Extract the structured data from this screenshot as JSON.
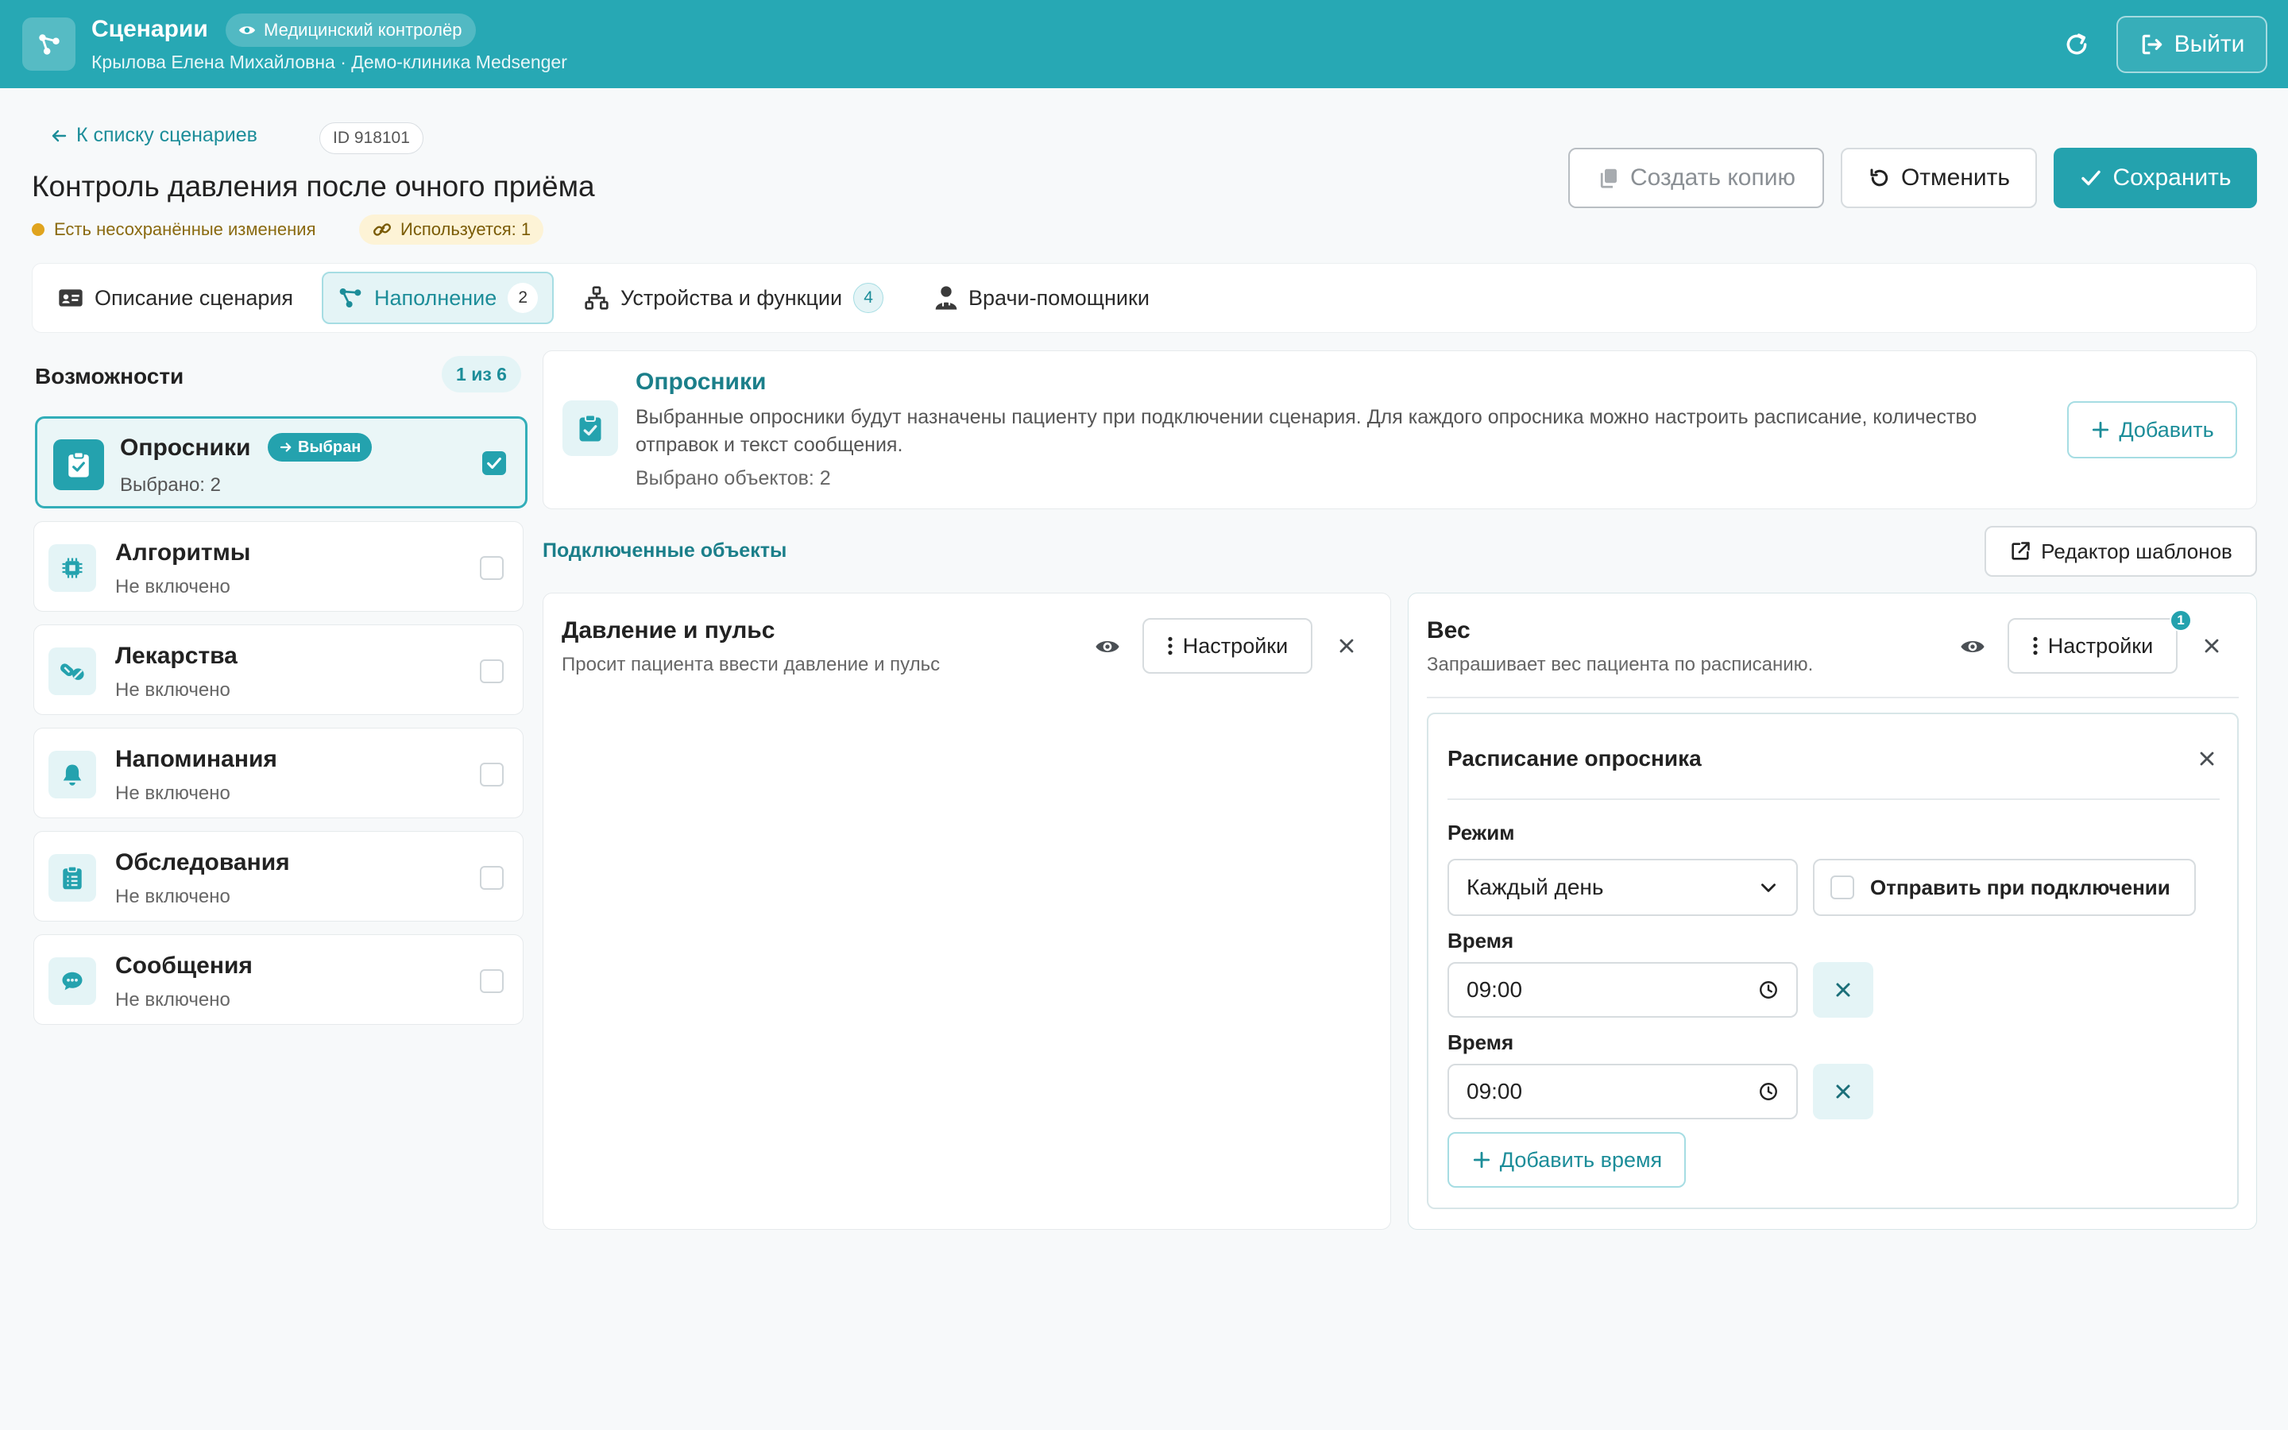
{
  "header": {
    "app_title": "Сценарии",
    "role_badge": "Медицинский контролёр",
    "user_line": "Крылова Елена Михайловна · Демо-клиника Medsenger",
    "logout_label": "Выйти",
    "accent_color": "#27a8b4"
  },
  "page": {
    "back_link": "К списку сценариев",
    "id_chip": "ID 918101",
    "title": "Контроль давления после очного приёма",
    "unsaved_text": "Есть несохранённые изменения",
    "used_text": "Используется: 1",
    "actions": {
      "copy_label": "Создать копию",
      "cancel_label": "Отменить",
      "save_label": "Сохранить"
    }
  },
  "tabs": [
    {
      "label": "Описание сценария",
      "count": null,
      "icon": "id-card-icon"
    },
    {
      "label": "Наполнение",
      "count": "2",
      "icon": "nodes-icon",
      "active": true
    },
    {
      "label": "Устройства и функции",
      "count": "4",
      "icon": "network-icon"
    },
    {
      "label": "Врачи-помощники",
      "count": null,
      "icon": "user-doctor-icon"
    }
  ],
  "capabilities": {
    "title": "Возможности",
    "count": "1 из 6",
    "selected_pill": "Выбран",
    "items": [
      {
        "name": "Опросники",
        "status": "Выбрано: 2",
        "icon": "clipboard-check-icon",
        "selected": true
      },
      {
        "name": "Алгоритмы",
        "status": "Не включено",
        "icon": "chip-icon",
        "selected": false
      },
      {
        "name": "Лекарства",
        "status": "Не включено",
        "icon": "pills-icon",
        "selected": false
      },
      {
        "name": "Напоминания",
        "status": "Не включено",
        "icon": "bell-icon",
        "selected": false
      },
      {
        "name": "Обследования",
        "status": "Не включено",
        "icon": "clipboard-list-icon",
        "selected": false
      },
      {
        "name": "Сообщения",
        "status": "Не включено",
        "icon": "chat-icon",
        "selected": false
      }
    ]
  },
  "info": {
    "title": "Опросники",
    "description": "Выбранные опросники будут назначены пациенту при подключении сценария. Для каждого опросника можно настроить расписание, количество отправок и текст сообщения.",
    "count_text": "Выбрано объектов: 2",
    "add_label": "Добавить"
  },
  "connected": {
    "title": "Подключенные объекты",
    "template_editor_label": "Редактор шаблонов",
    "objects": [
      {
        "name": "Давление и пульс",
        "description": "Просит пациента ввести давление и пульс",
        "settings_label": "Настройки"
      },
      {
        "name": "Вес",
        "description": "Запрашивает вес пациента по расписанию.",
        "settings_label": "Настройки",
        "badge": "1"
      }
    ]
  },
  "schedule": {
    "title": "Расписание опросника",
    "mode_label": "Режим",
    "mode_value": "Каждый день",
    "send_on_connect_label": "Отправить при подключении",
    "time_label": "Время",
    "times": [
      "09:00",
      "09:00"
    ],
    "add_time_label": "Добавить время"
  }
}
